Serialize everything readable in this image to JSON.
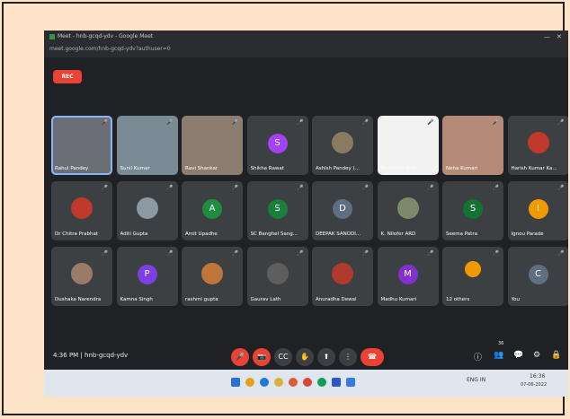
{
  "browser": {
    "tab_title": "Meet - hnb-gcqd-ydv - Google Meet",
    "url": "meet.google.com/hnb-gcqd-ydv?authuser=0",
    "min_label": "—",
    "close_label": "✕"
  },
  "recording_badge": "REC",
  "participants": [
    {
      "name": "Rahul Pandey",
      "type": "video",
      "speaking": true,
      "color": "#6b6f75"
    },
    {
      "name": "Sunil Kumar",
      "type": "video",
      "color": "#7a8a94"
    },
    {
      "name": "Ravi Shankar",
      "type": "video",
      "color": "#8c7d70"
    },
    {
      "name": "Shikha Rawat",
      "type": "avatar",
      "initial": "S",
      "color": "#a142f4"
    },
    {
      "name": "Ashish Pandey (...",
      "type": "photo",
      "color": "#8a7a62"
    },
    {
      "name": "Shubham Kum...",
      "type": "video",
      "color": "#f2f2f2"
    },
    {
      "name": "Neha Kumari",
      "type": "video",
      "color": "#b58a78"
    },
    {
      "name": "Harish Kumar Ka...",
      "type": "photo",
      "color": "#c0392b"
    },
    {
      "name": "Dr Chitra Prabhat",
      "type": "photo",
      "color": "#c0392b"
    },
    {
      "name": "Aditi Gupta",
      "type": "photo",
      "color": "#8e9aa3"
    },
    {
      "name": "Amit Upadhe",
      "type": "avatar",
      "initial": "A",
      "color": "#1e8e3e"
    },
    {
      "name": "SC Banghel Sang...",
      "type": "avatar",
      "initial": "S",
      "color": "#188038"
    },
    {
      "name": "DEEPAK SANODI...",
      "type": "avatar",
      "initial": "D",
      "color": "#5f6f82"
    },
    {
      "name": "K. Nilofer ARD",
      "type": "photo",
      "color": "#7d8a6a"
    },
    {
      "name": "Seema Patra",
      "type": "avatar",
      "initial": "S",
      "color": "#137333"
    },
    {
      "name": "Ignou Parade",
      "type": "avatar",
      "initial": "I",
      "color": "#f29900"
    },
    {
      "name": "Dushaka Narendra",
      "type": "photo",
      "color": "#9a7b6a"
    },
    {
      "name": "Kamna Singh",
      "type": "avatar",
      "initial": "P",
      "color": "#7b3fe4"
    },
    {
      "name": "rashmi gupta",
      "type": "photo",
      "color": "#c0763a"
    },
    {
      "name": "Gaurav Lath",
      "type": "photo",
      "color": "#5e5e5e"
    },
    {
      "name": "Anuradha Dewal",
      "type": "photo",
      "color": "#b03a2e"
    },
    {
      "name": "Madhu Kumari",
      "type": "avatar",
      "initial": "M",
      "color": "#8430ce"
    },
    {
      "name": "12 others",
      "type": "others",
      "color": "#f29900"
    },
    {
      "name": "You",
      "type": "avatar",
      "initial": "C",
      "color": "#5f6f82"
    }
  ],
  "meeting_info": "4:36 PM | hnb-gcqd-ydv",
  "controls": {
    "mic": "🎤",
    "cam": "📷",
    "captions": "CC",
    "raise": "✋",
    "present": "⬆",
    "more": "⋮",
    "end": "☎"
  },
  "right_controls": {
    "info": "ⓘ",
    "people": "👥",
    "people_count": "36",
    "chat": "💬",
    "activities": "⚙",
    "host": "🔒"
  },
  "taskbar": {
    "tray_text": "ENG IN",
    "time": "16:36",
    "date": "07-06-2022"
  }
}
